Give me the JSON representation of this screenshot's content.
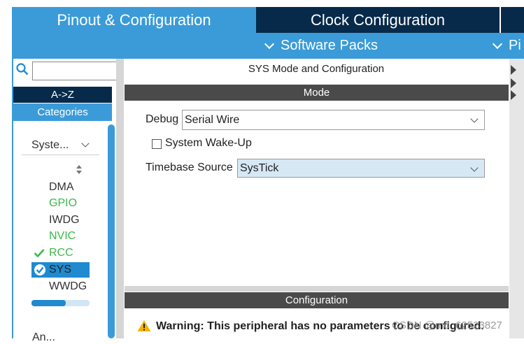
{
  "tabs": {
    "pinout": "Pinout & Configuration",
    "clock": "Clock Configuration"
  },
  "subbar": {
    "software_packs": "Software Packs",
    "partial": "Pi"
  },
  "left": {
    "search_value": "",
    "az": "A->Z",
    "categories": "Categories",
    "category_select": "Syste...",
    "items": [
      {
        "label": "DMA",
        "color": "#333333"
      },
      {
        "label": "GPIO",
        "color": "#3db84a"
      },
      {
        "label": "IWDG",
        "color": "#333333"
      },
      {
        "label": "NVIC",
        "color": "#3db84a"
      },
      {
        "label": "RCC",
        "color": "#3db84a",
        "checked": true
      },
      {
        "label": "SYS",
        "selected": true
      },
      {
        "label": "WWDG",
        "color": "#333333"
      }
    ],
    "partial_next": "An..."
  },
  "right": {
    "title": "SYS Mode and Configuration",
    "mode_header": "Mode",
    "debug_label": "Debug",
    "debug_value": "Serial Wire",
    "wakeup_label": "System Wake-Up",
    "wakeup_checked": false,
    "timebase_label": "Timebase Source",
    "timebase_value": "SysTick",
    "config_header": "Configuration",
    "warning": "Warning: This peripheral has no parameters to be configured."
  },
  "watermark": "CSDN @m0_62523827",
  "colors": {
    "accent_blue": "#3a9bd8",
    "dark_navy": "#072a4a",
    "green": "#3db84a",
    "select_blue": "#1f8ad0",
    "warning_yellow": "#f0b400"
  }
}
